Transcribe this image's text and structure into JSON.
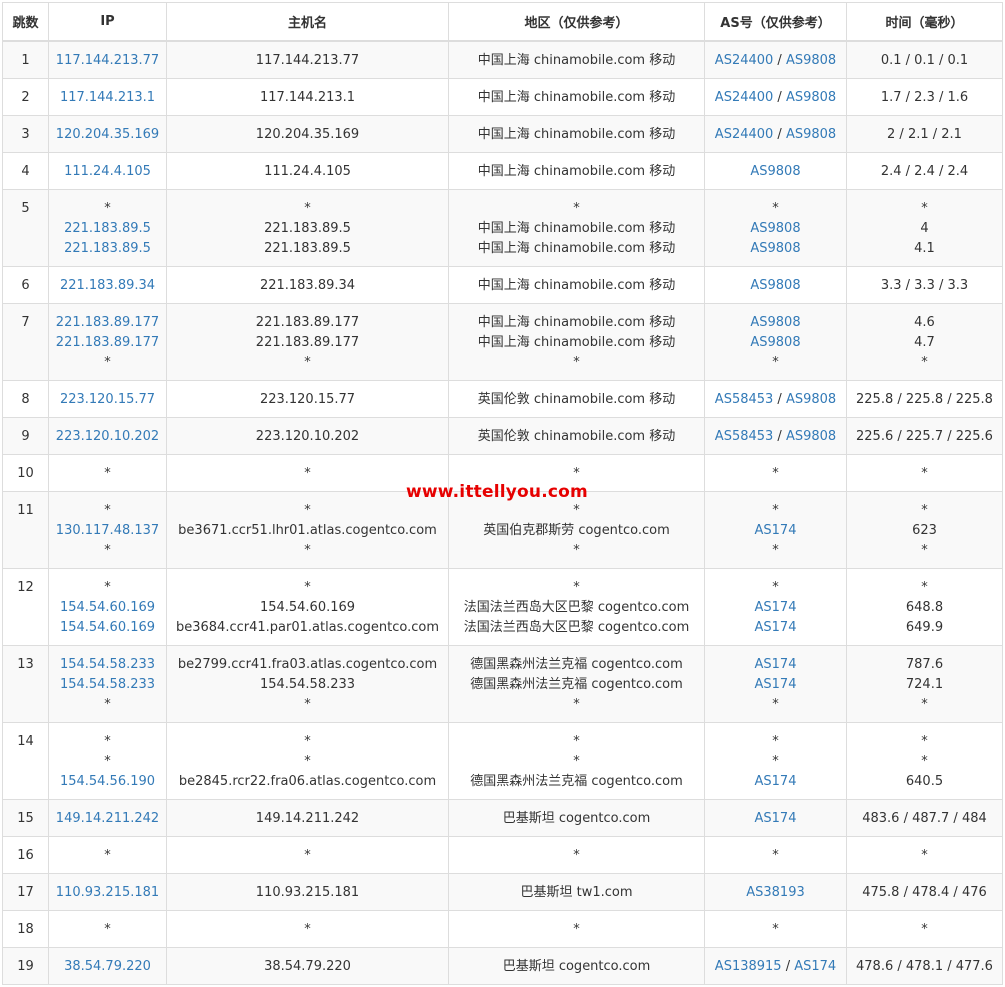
{
  "headers": [
    "跳数",
    "IP",
    "主机名",
    "地区（仅供参考）",
    "AS号（仅供参考）",
    "时间（毫秒）"
  ],
  "watermark": "www.ittellyou.com",
  "colors": {
    "link": "#337ab7",
    "watermark": "#e60000",
    "stripe": "#f9f9f9",
    "border": "#dddddd"
  },
  "hops": [
    {
      "hop": "1",
      "ip": [
        "117.144.213.77"
      ],
      "host": [
        "117.144.213.77"
      ],
      "region": [
        "中国上海 chinamobile.com 移动"
      ],
      "as": [
        [
          "AS24400",
          "AS9808"
        ]
      ],
      "time": [
        "0.1 / 0.1 / 0.1"
      ]
    },
    {
      "hop": "2",
      "ip": [
        "117.144.213.1"
      ],
      "host": [
        "117.144.213.1"
      ],
      "region": [
        "中国上海 chinamobile.com 移动"
      ],
      "as": [
        [
          "AS24400",
          "AS9808"
        ]
      ],
      "time": [
        "1.7 / 2.3 / 1.6"
      ]
    },
    {
      "hop": "3",
      "ip": [
        "120.204.35.169"
      ],
      "host": [
        "120.204.35.169"
      ],
      "region": [
        "中国上海 chinamobile.com 移动"
      ],
      "as": [
        [
          "AS24400",
          "AS9808"
        ]
      ],
      "time": [
        "2 / 2.1 / 2.1"
      ]
    },
    {
      "hop": "4",
      "ip": [
        "111.24.4.105"
      ],
      "host": [
        "111.24.4.105"
      ],
      "region": [
        "中国上海 chinamobile.com 移动"
      ],
      "as": [
        [
          "AS9808"
        ]
      ],
      "time": [
        "2.4 / 2.4 / 2.4"
      ]
    },
    {
      "hop": "5",
      "ip": [
        "*",
        "221.183.89.5",
        "221.183.89.5"
      ],
      "host": [
        "*",
        "221.183.89.5",
        "221.183.89.5"
      ],
      "region": [
        "*",
        "中国上海 chinamobile.com 移动",
        "中国上海 chinamobile.com 移动"
      ],
      "as": [
        [
          "*"
        ],
        [
          "AS9808"
        ],
        [
          "AS9808"
        ]
      ],
      "time": [
        "*",
        "4",
        "4.1"
      ]
    },
    {
      "hop": "6",
      "ip": [
        "221.183.89.34"
      ],
      "host": [
        "221.183.89.34"
      ],
      "region": [
        "中国上海 chinamobile.com 移动"
      ],
      "as": [
        [
          "AS9808"
        ]
      ],
      "time": [
        "3.3 / 3.3 / 3.3"
      ]
    },
    {
      "hop": "7",
      "ip": [
        "221.183.89.177",
        "221.183.89.177",
        "*"
      ],
      "host": [
        "221.183.89.177",
        "221.183.89.177",
        "*"
      ],
      "region": [
        "中国上海 chinamobile.com 移动",
        "中国上海 chinamobile.com 移动",
        "*"
      ],
      "as": [
        [
          "AS9808"
        ],
        [
          "AS9808"
        ],
        [
          "*"
        ]
      ],
      "time": [
        "4.6",
        "4.7",
        "*"
      ]
    },
    {
      "hop": "8",
      "ip": [
        "223.120.15.77"
      ],
      "host": [
        "223.120.15.77"
      ],
      "region": [
        "英国伦敦 chinamobile.com 移动"
      ],
      "as": [
        [
          "AS58453",
          "AS9808"
        ]
      ],
      "time": [
        "225.8 / 225.8 / 225.8"
      ]
    },
    {
      "hop": "9",
      "ip": [
        "223.120.10.202"
      ],
      "host": [
        "223.120.10.202"
      ],
      "region": [
        "英国伦敦 chinamobile.com 移动"
      ],
      "as": [
        [
          "AS58453",
          "AS9808"
        ]
      ],
      "time": [
        "225.6 / 225.7 / 225.6"
      ]
    },
    {
      "hop": "10",
      "ip": [
        "*"
      ],
      "host": [
        "*"
      ],
      "region": [
        "*"
      ],
      "as": [
        [
          "*"
        ]
      ],
      "time": [
        "*"
      ]
    },
    {
      "hop": "11",
      "ip": [
        "*",
        "130.117.48.137",
        "*"
      ],
      "host": [
        "*",
        "be3671.ccr51.lhr01.atlas.cogentco.com",
        "*"
      ],
      "region": [
        "*",
        "英国伯克郡斯劳 cogentco.com",
        "*"
      ],
      "as": [
        [
          "*"
        ],
        [
          "AS174"
        ],
        [
          "*"
        ]
      ],
      "time": [
        "*",
        "623",
        "*"
      ]
    },
    {
      "hop": "12",
      "ip": [
        "*",
        "154.54.60.169",
        "154.54.60.169"
      ],
      "host": [
        "*",
        "154.54.60.169",
        "be3684.ccr41.par01.atlas.cogentco.com"
      ],
      "region": [
        "*",
        "法国法兰西岛大区巴黎 cogentco.com",
        "法国法兰西岛大区巴黎 cogentco.com"
      ],
      "as": [
        [
          "*"
        ],
        [
          "AS174"
        ],
        [
          "AS174"
        ]
      ],
      "time": [
        "*",
        "648.8",
        "649.9"
      ]
    },
    {
      "hop": "13",
      "ip": [
        "154.54.58.233",
        "154.54.58.233",
        "*"
      ],
      "host": [
        "be2799.ccr41.fra03.atlas.cogentco.com",
        "154.54.58.233",
        "*"
      ],
      "region": [
        "德国黑森州法兰克福 cogentco.com",
        "德国黑森州法兰克福 cogentco.com",
        "*"
      ],
      "as": [
        [
          "AS174"
        ],
        [
          "AS174"
        ],
        [
          "*"
        ]
      ],
      "time": [
        "787.6",
        "724.1",
        "*"
      ]
    },
    {
      "hop": "14",
      "ip": [
        "*",
        "*",
        "154.54.56.190"
      ],
      "host": [
        "*",
        "*",
        "be2845.rcr22.fra06.atlas.cogentco.com"
      ],
      "region": [
        "*",
        "*",
        "德国黑森州法兰克福 cogentco.com"
      ],
      "as": [
        [
          "*"
        ],
        [
          "*"
        ],
        [
          "AS174"
        ]
      ],
      "time": [
        "*",
        "*",
        "640.5"
      ]
    },
    {
      "hop": "15",
      "ip": [
        "149.14.211.242"
      ],
      "host": [
        "149.14.211.242"
      ],
      "region": [
        "巴基斯坦 cogentco.com"
      ],
      "as": [
        [
          "AS174"
        ]
      ],
      "time": [
        "483.6 / 487.7 / 484"
      ]
    },
    {
      "hop": "16",
      "ip": [
        "*"
      ],
      "host": [
        "*"
      ],
      "region": [
        "*"
      ],
      "as": [
        [
          "*"
        ]
      ],
      "time": [
        "*"
      ]
    },
    {
      "hop": "17",
      "ip": [
        "110.93.215.181"
      ],
      "host": [
        "110.93.215.181"
      ],
      "region": [
        "巴基斯坦 tw1.com"
      ],
      "as": [
        [
          "AS38193"
        ]
      ],
      "time": [
        "475.8 / 478.4 / 476"
      ]
    },
    {
      "hop": "18",
      "ip": [
        "*"
      ],
      "host": [
        "*"
      ],
      "region": [
        "*"
      ],
      "as": [
        [
          "*"
        ]
      ],
      "time": [
        "*"
      ]
    },
    {
      "hop": "19",
      "ip": [
        "38.54.79.220"
      ],
      "host": [
        "38.54.79.220"
      ],
      "region": [
        "巴基斯坦 cogentco.com"
      ],
      "as": [
        [
          "AS138915",
          "AS174"
        ]
      ],
      "time": [
        "478.6 / 478.1 / 477.6"
      ]
    }
  ]
}
